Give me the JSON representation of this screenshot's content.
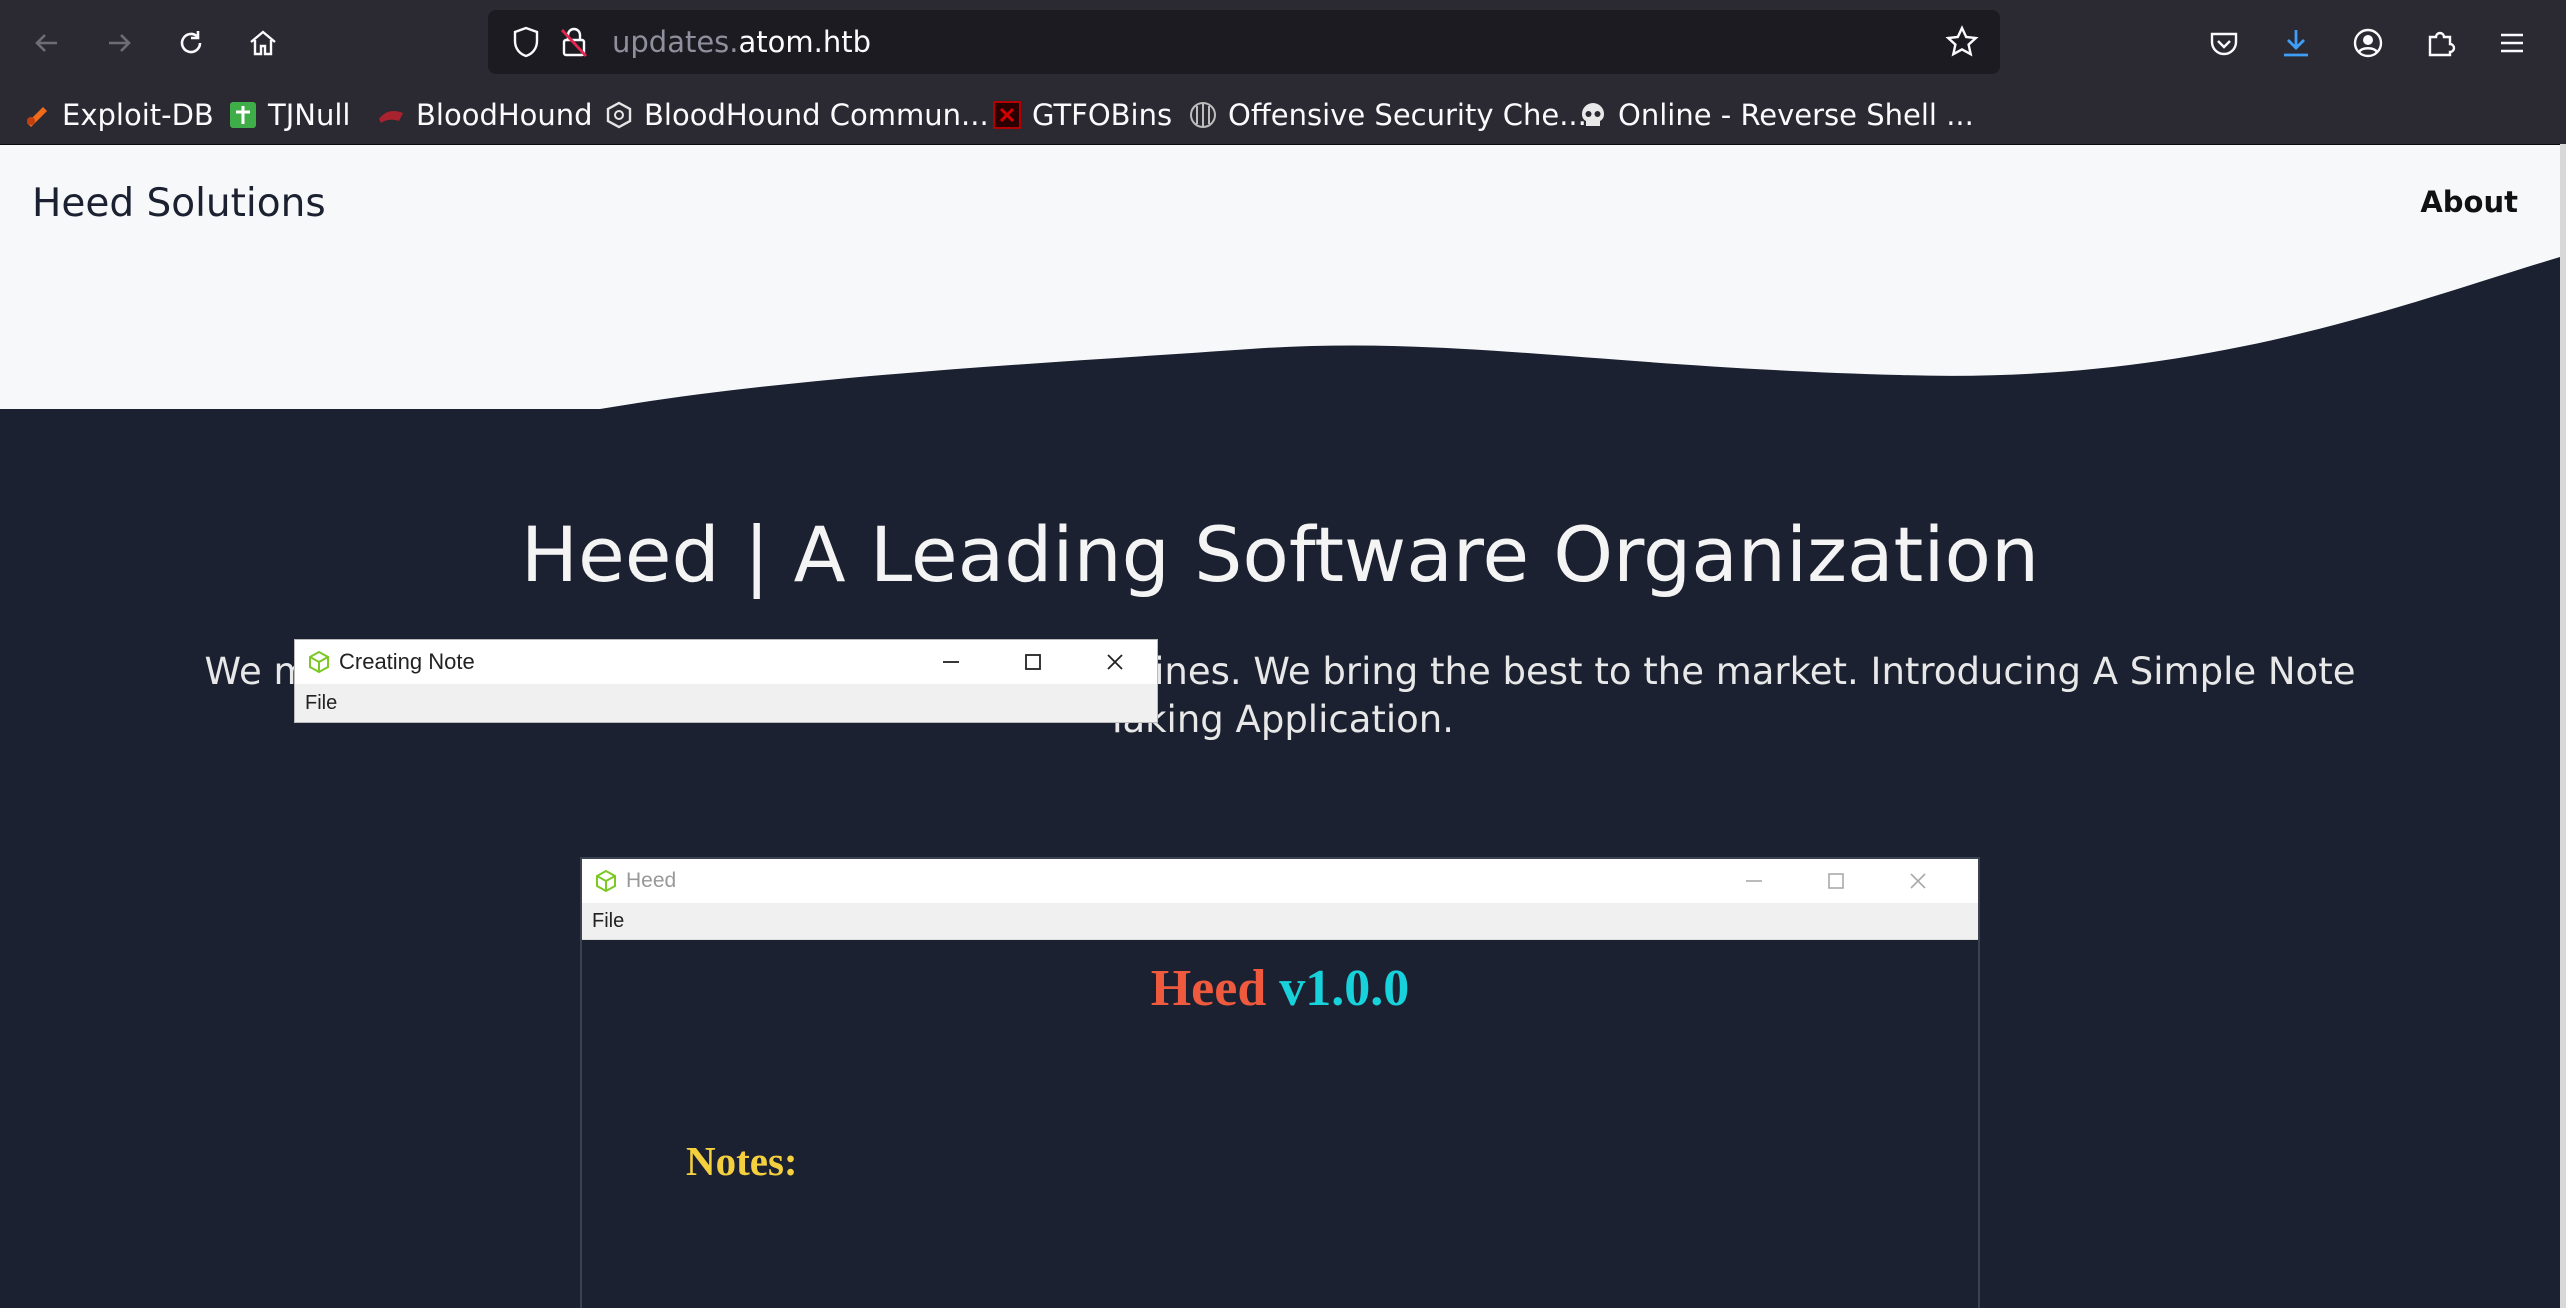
{
  "browser": {
    "url_prefix": "updates.",
    "url_domain": "atom.htb",
    "bookmarks": [
      {
        "label": "Exploit-DB",
        "icon": "exploit-db-icon"
      },
      {
        "label": "TJNull",
        "icon": "tjnull-icon"
      },
      {
        "label": "BloodHound",
        "icon": "bloodhound-icon"
      },
      {
        "label": "BloodHound Commun...",
        "icon": "bloodhound-community-icon"
      },
      {
        "label": "GTFOBins",
        "icon": "gtfobins-icon"
      },
      {
        "label": "Offensive Security Che...",
        "icon": "offsec-icon"
      },
      {
        "label": "Online - Reverse Shell ...",
        "icon": "skull-icon"
      }
    ]
  },
  "site": {
    "brand": "Heed Solutions",
    "nav_about": "About",
    "headline": "Heed | A Leading Software Organization",
    "subline": "We make software to help people in their daily routines. We bring the best to the market. Introducing A Simple Note Taking Application."
  },
  "app": {
    "window_title": "Heed",
    "menu_file": "File",
    "heading_name": "Heed",
    "heading_version": "v1.0.0",
    "notes_label": "Notes:",
    "dialog_title": "Creating Note",
    "dialog_menu_file": "File"
  },
  "colors": {
    "page_bg": "#1b2130",
    "heading_name": "#ef5a3f",
    "heading_version": "#17d2da",
    "notes_label": "#f4d03f"
  }
}
